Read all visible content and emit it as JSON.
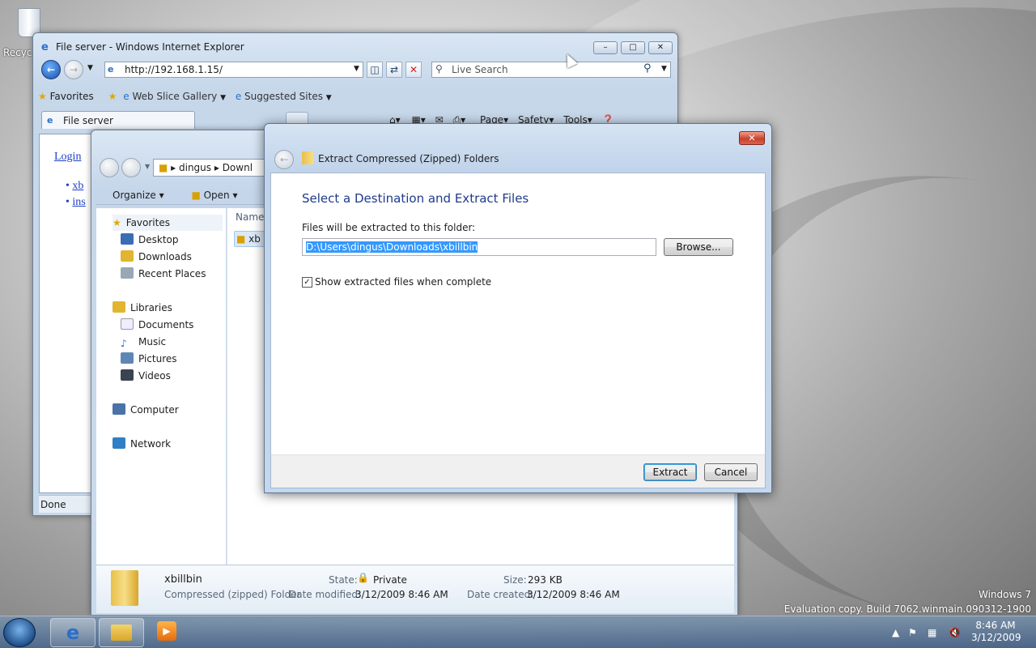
{
  "desktop": {
    "recycle_bin_label": "Recyc",
    "watermark": {
      "line1": "Windows 7",
      "line2": "Evaluation copy. Build 7062.winmain.090312-1900"
    }
  },
  "ie": {
    "title": "File server - Windows Internet Explorer",
    "address": "http://192.168.1.15/",
    "search_placeholder": "Live Search",
    "favorites_label": "Favorites",
    "web_slice_label": "Web Slice Gallery",
    "suggested_sites_label": "Suggested Sites",
    "tab_label": "File server",
    "cmd": {
      "page": "Page",
      "safety": "Safety",
      "tools": "Tools"
    },
    "content": {
      "login": "Login",
      "links": [
        "xb",
        "ins"
      ]
    },
    "status": "Done"
  },
  "explorer": {
    "breadcrumb": [
      "dingus",
      "Downl"
    ],
    "organize_label": "Organize",
    "open_label": "Open",
    "column_name": "Name",
    "file_item": "xb",
    "nav": {
      "favorites": {
        "label": "Favorites",
        "items": [
          "Desktop",
          "Downloads",
          "Recent Places"
        ]
      },
      "libraries": {
        "label": "Libraries",
        "items": [
          "Documents",
          "Music",
          "Pictures",
          "Videos"
        ]
      },
      "computer": "Computer",
      "network": "Network"
    },
    "details": {
      "name": "xbillbin",
      "type": "Compressed (zipped) Folder",
      "state_label": "State:",
      "state_value": "Private",
      "modified_label": "Date modified:",
      "modified_value": "3/12/2009 8:46 AM",
      "size_label": "Size:",
      "size_value": "293 KB",
      "created_label": "Date created:",
      "created_value": "3/12/2009 8:46 AM"
    }
  },
  "dialog": {
    "title": "Extract Compressed (Zipped) Folders",
    "heading": "Select a Destination and Extract Files",
    "folder_label": "Files will be extracted to this folder:",
    "path_value": "D:\\Users\\dingus\\Downloads\\xbillbin",
    "browse_label": "Browse...",
    "show_files_label": "Show extracted files when complete",
    "show_files_checked": true,
    "extract_label": "Extract",
    "cancel_label": "Cancel"
  },
  "taskbar": {
    "time": "8:46 AM",
    "date": "3/12/2009"
  },
  "colors": {
    "accent": "#1e3a8c",
    "selection": "#3399ff",
    "link": "#1b3fc6"
  }
}
